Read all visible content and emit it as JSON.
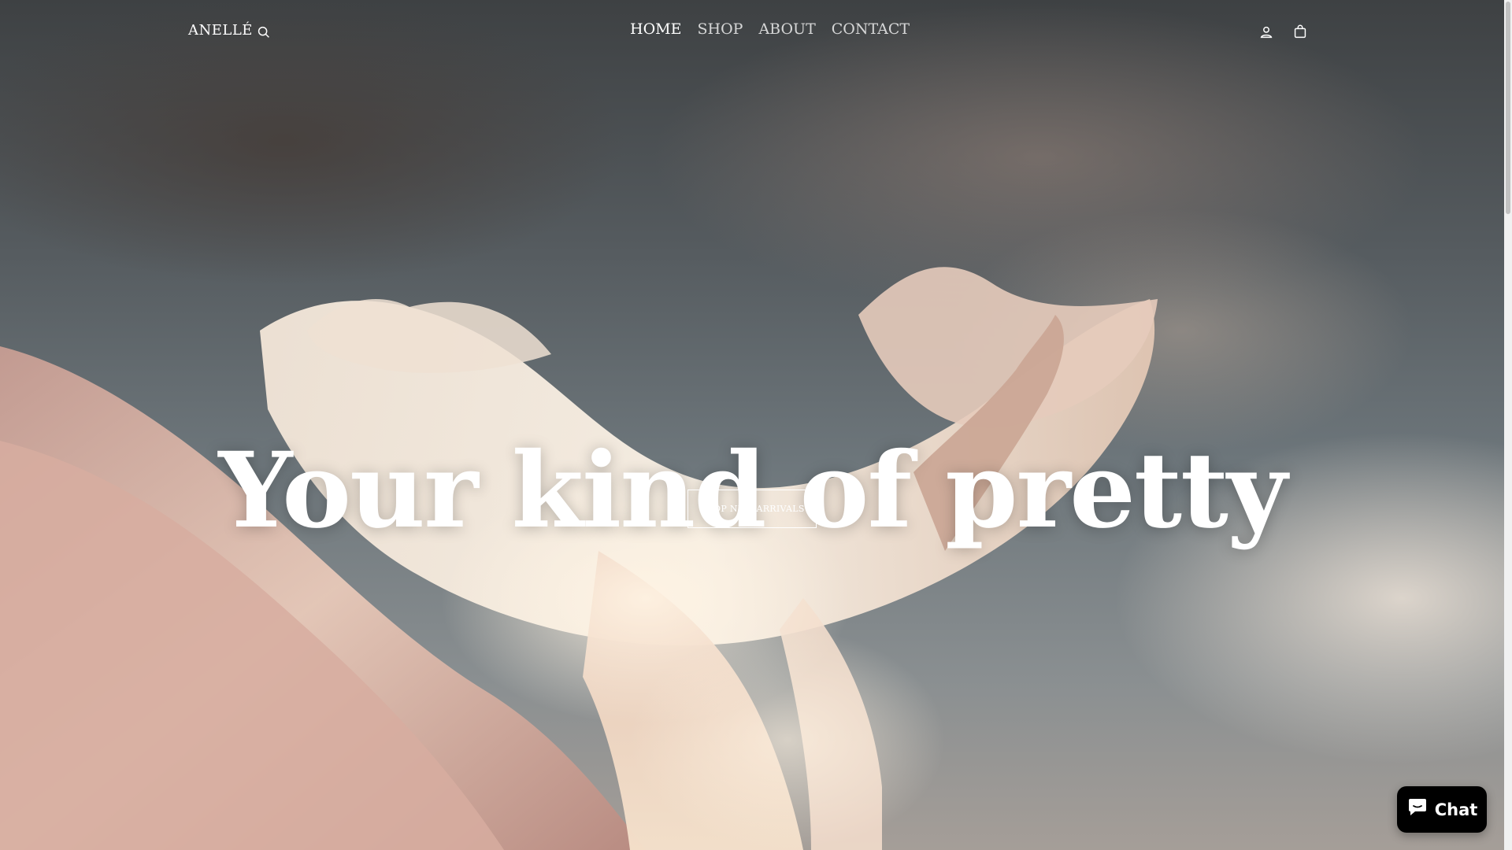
{
  "header": {
    "logo": "ANELLÉ",
    "nav": [
      {
        "label": "HOME",
        "active": true
      },
      {
        "label": "SHOP",
        "active": false
      },
      {
        "label": "ABOUT",
        "active": false
      },
      {
        "label": "CONTACT",
        "active": false
      }
    ],
    "icons": {
      "search": "search-icon",
      "account": "user-icon",
      "cart": "shopping-bag-icon"
    }
  },
  "hero": {
    "headline": "Your kind of pretty",
    "cta_label": "SHOP NEW ARRIVALS"
  },
  "chat": {
    "label": "Chat",
    "icon": "chat-bubble-icon",
    "background": "#000000"
  },
  "colors": {
    "text": "#ffffff",
    "fabric": "#f1d7c6"
  }
}
